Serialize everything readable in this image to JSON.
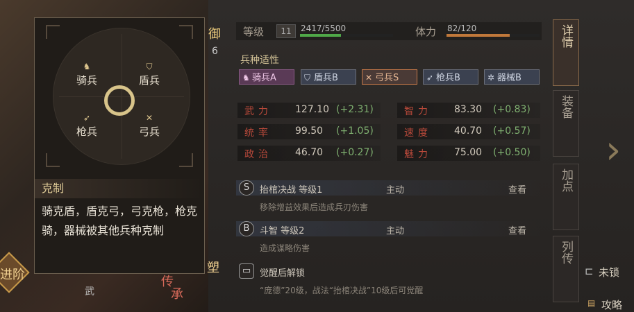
{
  "left_tags": {
    "defense_label": "御",
    "defense_value": "6",
    "bottom_left": "进阶",
    "bottom_mid": "武",
    "bottom_right_a": "塑",
    "bottom_right_b": "传",
    "bottom_right_c": "承"
  },
  "stats_bar": {
    "level_label": "等级",
    "level_value": "11",
    "exp_text": "2417/5500",
    "exp_ratio": 0.44,
    "stamina_label": "体力",
    "stamina_text": "82/120",
    "stamina_ratio": 0.68,
    "exp_color": "#4fa848",
    "stamina_color": "#c0783a"
  },
  "aptitude": {
    "title": "兵种适性",
    "items": [
      {
        "label": "骑兵A",
        "icon": "horse-icon"
      },
      {
        "label": "盾兵B",
        "icon": "shield-icon"
      },
      {
        "label": "弓兵S",
        "icon": "bow-icon"
      },
      {
        "label": "枪兵B",
        "icon": "spear-icon"
      },
      {
        "label": "器械B",
        "icon": "gear-icon"
      }
    ]
  },
  "attributes": [
    {
      "name": "武力",
      "value": "127.10",
      "bonus": "(+2.31)"
    },
    {
      "name": "智力",
      "value": "83.30",
      "bonus": "(+0.83)"
    },
    {
      "name": "统率",
      "value": "99.50",
      "bonus": "(+1.05)"
    },
    {
      "name": "速度",
      "value": "40.70",
      "bonus": "(+0.57)"
    },
    {
      "name": "政治",
      "value": "46.70",
      "bonus": "(+0.27)"
    },
    {
      "name": "魅力",
      "value": "75.00",
      "bonus": "(+0.50)"
    }
  ],
  "skills": [
    {
      "grade": "S",
      "name": "抬棺决战 等级1",
      "type": "主动",
      "view": "查看",
      "desc": "移除增益效果后造成兵刃伤害"
    },
    {
      "grade": "B",
      "name": "斗智 等级2",
      "type": "主动",
      "view": "查看",
      "desc": "造成谋略伤害"
    }
  ],
  "awaken": {
    "title": "觉醒后解锁",
    "desc": "“庞德”20级，战法“抬棺决战”10级后可觉醒"
  },
  "tabs": [
    "详情",
    "装备",
    "加点",
    "列传"
  ],
  "right_side": {
    "unlock_text": "未锁",
    "guide_text": "攻略"
  },
  "popup": {
    "units": {
      "cavalry": "骑兵",
      "shield": "盾兵",
      "spear": "枪兵",
      "bow": "弓兵"
    },
    "title": "克制",
    "text": "骑克盾，盾克弓，弓克枪，枪克骑，器械被其他兵种克制"
  }
}
